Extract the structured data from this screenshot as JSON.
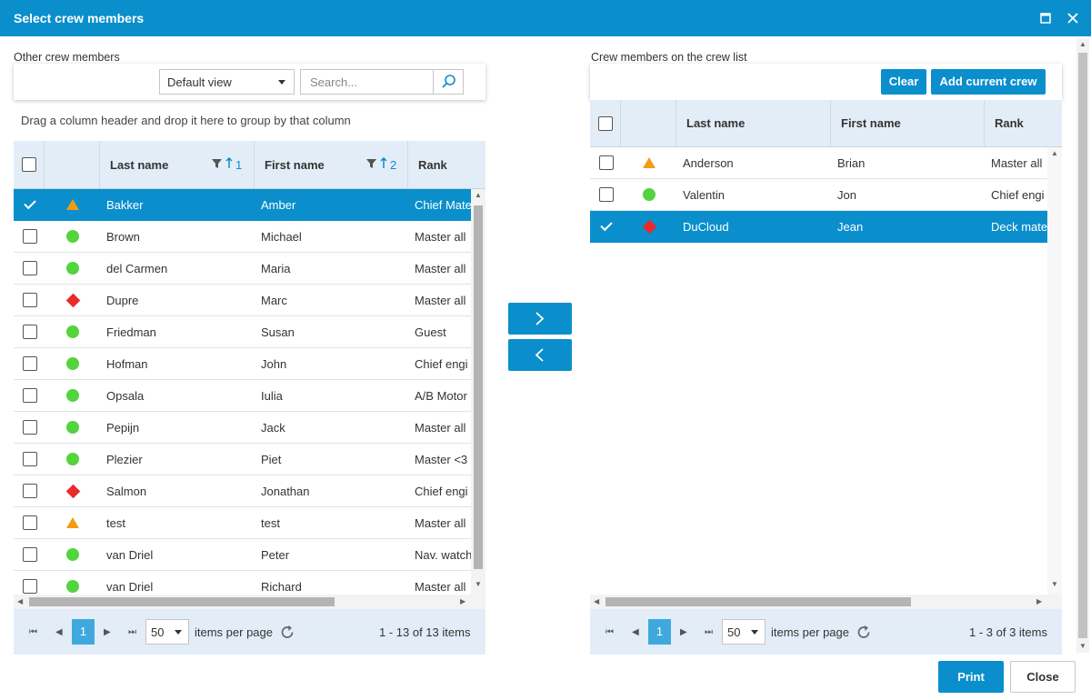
{
  "window": {
    "title": "Select crew members",
    "maximize_icon": "maximize-icon",
    "close_icon": "close-icon"
  },
  "left": {
    "section_label": "Other crew members",
    "view_select": "Default view",
    "search_placeholder": "Search...",
    "group_hint": "Drag a column header and drop it here to group by that column",
    "columns": {
      "last_name": "Last name",
      "first_name": "First name",
      "rank": "Rank"
    },
    "sort": {
      "last_name_order": "1",
      "first_name_order": "2"
    },
    "rows": [
      {
        "status": "triangle",
        "last": "Bakker",
        "first": "Amber",
        "rank": "Chief Mate",
        "selected": true
      },
      {
        "status": "dot",
        "last": "Brown",
        "first": "Michael",
        "rank": "Master all",
        "selected": false
      },
      {
        "status": "dot",
        "last": "del Carmen",
        "first": "Maria",
        "rank": "Master all",
        "selected": false
      },
      {
        "status": "diamond",
        "last": "Dupre",
        "first": "Marc",
        "rank": "Master all",
        "selected": false
      },
      {
        "status": "dot",
        "last": "Friedman",
        "first": "Susan",
        "rank": "Guest",
        "selected": false
      },
      {
        "status": "dot",
        "last": "Hofman",
        "first": "John",
        "rank": "Chief engi",
        "selected": false
      },
      {
        "status": "dot",
        "last": "Opsala",
        "first": "Iulia",
        "rank": "A/B Motor",
        "selected": false
      },
      {
        "status": "dot",
        "last": "Pepijn",
        "first": "Jack",
        "rank": "Master all",
        "selected": false
      },
      {
        "status": "dot",
        "last": "Plezier",
        "first": "Piet",
        "rank": "Master <3",
        "selected": false
      },
      {
        "status": "diamond",
        "last": "Salmon",
        "first": "Jonathan",
        "rank": "Chief engi",
        "selected": false
      },
      {
        "status": "triangle",
        "last": "test",
        "first": "test",
        "rank": "Master all",
        "selected": false
      },
      {
        "status": "dot",
        "last": "van Driel",
        "first": "Peter",
        "rank": "Nav. watch",
        "selected": false
      },
      {
        "status": "dot",
        "last": "van Driel",
        "first": "Richard",
        "rank": "Master all",
        "selected": false
      }
    ],
    "pager": {
      "page": "1",
      "page_size": "50",
      "per_page_label": "items per page",
      "summary": "1 - 13 of 13 items"
    }
  },
  "right": {
    "section_label": "Crew members on the crew list",
    "clear_label": "Clear",
    "add_current_label": "Add current crew",
    "columns": {
      "last_name": "Last name",
      "first_name": "First name",
      "rank": "Rank"
    },
    "rows": [
      {
        "status": "triangle",
        "last": "Anderson",
        "first": "Brian",
        "rank": "Master all",
        "selected": false
      },
      {
        "status": "dot",
        "last": "Valentin",
        "first": "Jon",
        "rank": "Chief engi",
        "selected": false
      },
      {
        "status": "diamond",
        "last": "DuCloud",
        "first": "Jean",
        "rank": "Deck mate",
        "selected": true
      }
    ],
    "pager": {
      "page": "1",
      "page_size": "50",
      "per_page_label": "items per page",
      "summary": "1 - 3 of 3 items"
    }
  },
  "middle": {
    "add_icon": "chevron-right-icon",
    "remove_icon": "chevron-left-icon"
  },
  "footer": {
    "print_label": "Print",
    "close_label": "Close"
  },
  "colors": {
    "accent": "#0a8fcc",
    "header_bg": "#e3edf7",
    "status_green": "#53d43c",
    "status_orange": "#f39c12",
    "status_red": "#ea2a2a"
  }
}
